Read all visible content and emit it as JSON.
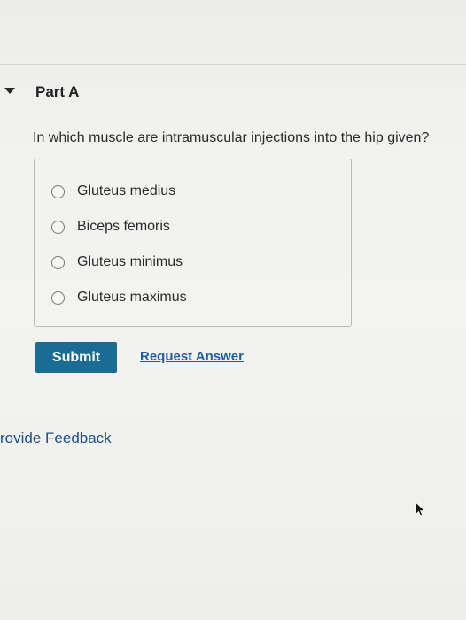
{
  "part": {
    "title": "Part A"
  },
  "question": {
    "text": "In which muscle are intramuscular injections into the hip given?"
  },
  "options": [
    {
      "label": "Gluteus medius"
    },
    {
      "label": "Biceps femoris"
    },
    {
      "label": "Gluteus minimus"
    },
    {
      "label": "Gluteus maximus"
    }
  ],
  "actions": {
    "submit_label": "Submit",
    "request_answer_label": "Request Answer"
  },
  "feedback": {
    "label": "rovide Feedback"
  },
  "colors": {
    "submit_bg": "#1a6c95",
    "link": "#1b5fa8"
  },
  "icons": {
    "collapse": "caret-down-icon",
    "radio": "radio-unselected-icon",
    "pointer": "mouse-pointer-icon"
  }
}
